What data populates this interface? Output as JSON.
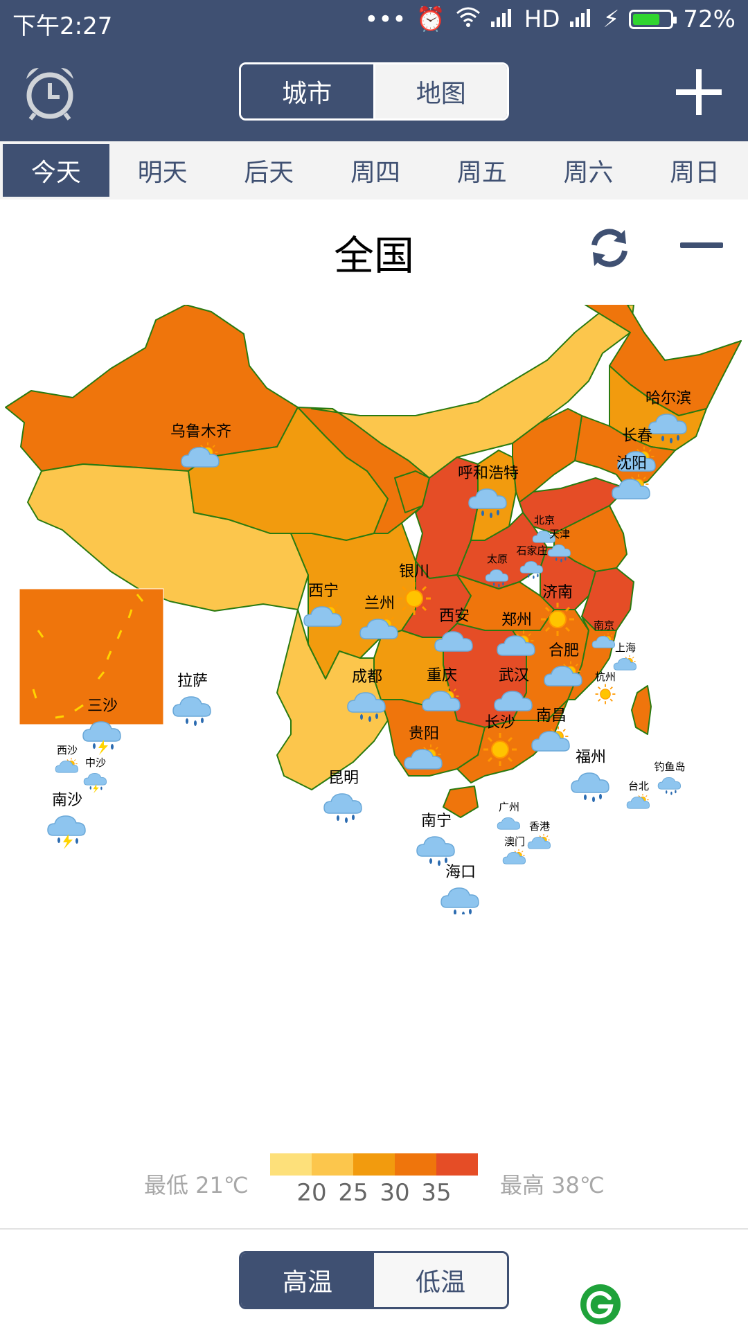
{
  "status_bar": {
    "time": "下午2:27",
    "network": "HD",
    "battery": "72%",
    "battery_level": 0.72
  },
  "header": {
    "alarm_icon": "alarm-clock-icon",
    "view_toggle": {
      "city_label": "城市",
      "map_label": "地图",
      "selected": "地图"
    },
    "add_icon": "plus-icon"
  },
  "day_tabs": [
    "今天",
    "明天",
    "后天",
    "周四",
    "周五",
    "周六",
    "周日"
  ],
  "selected_day": "今天",
  "region": {
    "title": "全国",
    "refresh_icon": "refresh-icon",
    "collapse_icon": "minus-icon"
  },
  "cities": [
    {
      "name": "乌鲁木齐",
      "weather": "partly-cloudy",
      "size": "l"
    },
    {
      "name": "哈尔滨",
      "weather": "rain",
      "size": "l"
    },
    {
      "name": "长春",
      "weather": "partly-cloudy",
      "size": "l"
    },
    {
      "name": "沈阳",
      "weather": "partly-cloudy",
      "size": "l"
    },
    {
      "name": "呼和浩特",
      "weather": "rain",
      "size": "l"
    },
    {
      "name": "北京",
      "weather": "cloudy",
      "size": "s"
    },
    {
      "name": "天津",
      "weather": "rain",
      "size": "s"
    },
    {
      "name": "石家庄",
      "weather": "rain",
      "size": "s"
    },
    {
      "name": "太原",
      "weather": "rain",
      "size": "s"
    },
    {
      "name": "银川",
      "weather": "sunny",
      "size": "l"
    },
    {
      "name": "济南",
      "weather": "sunny",
      "size": "l"
    },
    {
      "name": "西宁",
      "weather": "partly-cloudy",
      "size": "l"
    },
    {
      "name": "兰州",
      "weather": "partly-cloudy",
      "size": "l"
    },
    {
      "name": "西安",
      "weather": "cloudy",
      "size": "l"
    },
    {
      "name": "郑州",
      "weather": "partly-cloudy",
      "size": "l"
    },
    {
      "name": "合肥",
      "weather": "partly-cloudy",
      "size": "l"
    },
    {
      "name": "南京",
      "weather": "partly-cloudy",
      "size": "s"
    },
    {
      "name": "上海",
      "weather": "partly-cloudy",
      "size": "s"
    },
    {
      "name": "杭州",
      "weather": "sunny",
      "size": "s"
    },
    {
      "name": "拉萨",
      "weather": "rain",
      "size": "l"
    },
    {
      "name": "成都",
      "weather": "rain",
      "size": "l"
    },
    {
      "name": "重庆",
      "weather": "partly-cloudy",
      "size": "l"
    },
    {
      "name": "武汉",
      "weather": "cloudy",
      "size": "l"
    },
    {
      "name": "长沙",
      "weather": "sunny",
      "size": "l"
    },
    {
      "name": "南昌",
      "weather": "partly-cloudy",
      "size": "l"
    },
    {
      "name": "贵阳",
      "weather": "partly-cloudy",
      "size": "l"
    },
    {
      "name": "福州",
      "weather": "rain",
      "size": "l"
    },
    {
      "name": "钓鱼岛",
      "weather": "rain",
      "size": "s"
    },
    {
      "name": "台北",
      "weather": "partly-cloudy",
      "size": "s"
    },
    {
      "name": "昆明",
      "weather": "rain",
      "size": "l"
    },
    {
      "name": "南宁",
      "weather": "rain",
      "size": "l"
    },
    {
      "name": "广州",
      "weather": "cloudy",
      "size": "s"
    },
    {
      "name": "香港",
      "weather": "partly-cloudy",
      "size": "s"
    },
    {
      "name": "澳门",
      "weather": "partly-cloudy",
      "size": "s"
    },
    {
      "name": "海口",
      "weather": "rain",
      "size": "l"
    },
    {
      "name": "三沙",
      "weather": "thunderstorm",
      "size": "l"
    },
    {
      "name": "西沙",
      "weather": "partly-cloudy",
      "size": "s"
    },
    {
      "name": "中沙",
      "weather": "thunderstorm",
      "size": "s"
    },
    {
      "name": "南沙",
      "weather": "thunderstorm",
      "size": "l"
    }
  ],
  "legend": {
    "min_label": "最低 21℃",
    "max_label": "最高 38℃",
    "ticks": [
      "20",
      "25",
      "30",
      "35"
    ],
    "colors": [
      "#fde07a",
      "#fcc64c",
      "#f29b0e",
      "#ef750c",
      "#e54d26"
    ]
  },
  "temp_toggle": {
    "high_label": "高温",
    "low_label": "低温",
    "selected": "高温"
  },
  "colors": {
    "primary": "#3f5072",
    "map_border": "#2a7a10"
  }
}
